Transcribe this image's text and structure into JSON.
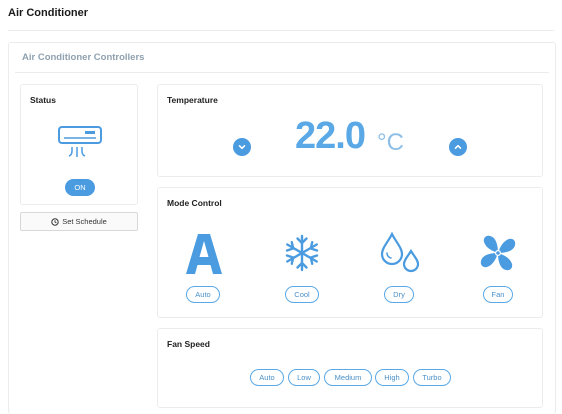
{
  "page": {
    "title": "Air Conditioner"
  },
  "panel": {
    "title": "Air Conditioner Controllers"
  },
  "status": {
    "title": "Status",
    "icon": "air-conditioner-icon",
    "power_label": "ON",
    "schedule_label": "Set Schedule",
    "schedule_icon": "clock-icon"
  },
  "temperature": {
    "title": "Temperature",
    "value": "22.0",
    "unit": "°C",
    "decrease_icon": "chevron-down-icon",
    "increase_icon": "chevron-up-icon"
  },
  "mode": {
    "title": "Mode Control",
    "options": [
      {
        "label": "Auto",
        "icon": "auto-letter-a-icon"
      },
      {
        "label": "Cool",
        "icon": "snowflake-icon"
      },
      {
        "label": "Dry",
        "icon": "water-drops-icon"
      },
      {
        "label": "Fan",
        "icon": "fan-icon"
      }
    ]
  },
  "fan_speed": {
    "title": "Fan Speed",
    "options": [
      "Auto",
      "Low",
      "Medium",
      "High",
      "Turbo"
    ]
  },
  "colors": {
    "accent": "#4a9be0",
    "accent_light": "#5aa9e6",
    "muted_title": "#8fa1b0",
    "border": "#ececec"
  }
}
